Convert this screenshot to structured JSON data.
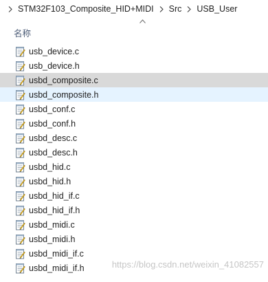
{
  "breadcrumb": {
    "items": [
      "STM32F103_Composite_HID+MIDI",
      "Src",
      "USB_User"
    ]
  },
  "columns": {
    "name_header": "名称"
  },
  "files": [
    {
      "name": "usb_device.c",
      "state": "normal"
    },
    {
      "name": "usb_device.h",
      "state": "normal"
    },
    {
      "name": "usbd_composite.c",
      "state": "selected"
    },
    {
      "name": "usbd_composite.h",
      "state": "hover"
    },
    {
      "name": "usbd_conf.c",
      "state": "normal"
    },
    {
      "name": "usbd_conf.h",
      "state": "normal"
    },
    {
      "name": "usbd_desc.c",
      "state": "normal"
    },
    {
      "name": "usbd_desc.h",
      "state": "normal"
    },
    {
      "name": "usbd_hid.c",
      "state": "normal"
    },
    {
      "name": "usbd_hid.h",
      "state": "normal"
    },
    {
      "name": "usbd_hid_if.c",
      "state": "normal"
    },
    {
      "name": "usbd_hid_if.h",
      "state": "normal"
    },
    {
      "name": "usbd_midi.c",
      "state": "normal"
    },
    {
      "name": "usbd_midi.h",
      "state": "normal"
    },
    {
      "name": "usbd_midi_if.c",
      "state": "normal"
    },
    {
      "name": "usbd_midi_if.h",
      "state": "normal"
    }
  ],
  "watermark": "https://blog.csdn.net/weixin_41082557",
  "colors": {
    "selected_bg": "#d9d9d9",
    "hover_bg": "#e5f3ff",
    "header_text": "#4a5a75"
  },
  "icons": {
    "breadcrumb_separator": "chevron-right-icon",
    "sort": "chevron-up-icon",
    "file": "notepad-file-icon"
  }
}
